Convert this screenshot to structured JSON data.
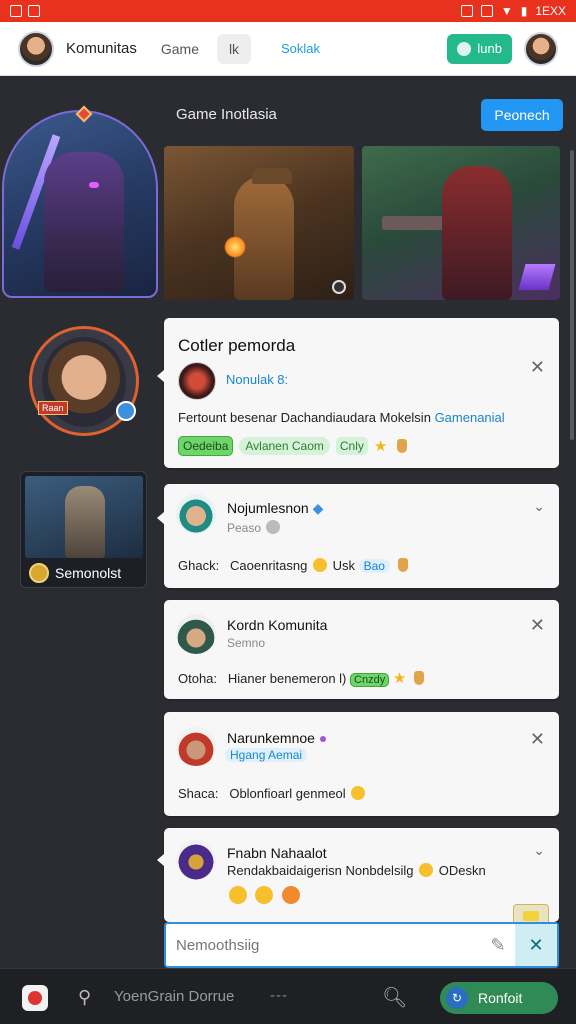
{
  "status": {
    "time": "1EXX"
  },
  "header": {
    "app_title": "Komunitas",
    "tab_game": "Game",
    "chip": "lk",
    "link": "Soklak",
    "action_button": "lunb"
  },
  "section": {
    "label": "Game Inotlasia",
    "button": "Peonech"
  },
  "profile": {
    "tag": "Raan"
  },
  "mini_card": {
    "label": "Semonolst"
  },
  "featured": {
    "title": "Cotler pemorda",
    "mention": "Nonulak 8:",
    "desc_plain": "Fertount besenar Dachandiaudara Mokelsin",
    "desc_link": "Gamenanial",
    "tags": [
      "Oedeiba",
      "Avlanen Caom",
      "Cnly"
    ]
  },
  "posts": [
    {
      "name": "Nojumlesnon",
      "sub": "Peaso",
      "label": "Ghack:",
      "body": "Caoenritasng",
      "extra": "Usk",
      "pill": "Bao"
    },
    {
      "name": "Kordn Komunita",
      "sub": "Semno",
      "label": "Otoha:",
      "body": "Hianer benemeron l)",
      "pill": "Cnzdy"
    },
    {
      "name": "Narunkemnoe",
      "sub": "Hgang Aemai",
      "label": "Shaca:",
      "body": "Oblonfioarl genmeol"
    },
    {
      "name": "Fnabn Nahaalot",
      "sub": "Rendakbaidaigerisn Nonbdelsilg",
      "extra": "ODeskn"
    }
  ],
  "composer": {
    "placeholder": "Nemoothsiig"
  },
  "bottom": {
    "field": "YoenGrain Dorrue",
    "dots": "---",
    "button": "Ronfoit"
  },
  "colors": {
    "accent": "#2196f3",
    "statusbar": "#e8321e",
    "success": "#23b98a",
    "bg": "#2b2c31"
  }
}
